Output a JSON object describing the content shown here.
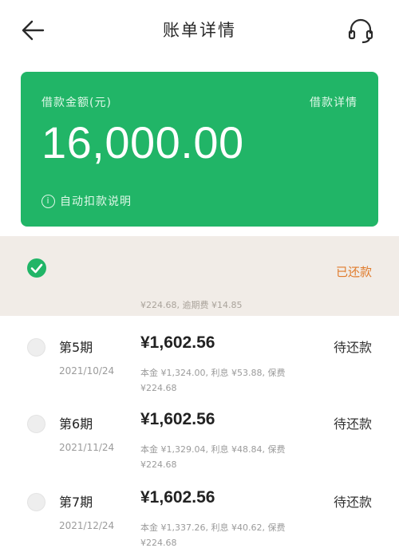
{
  "header": {
    "title": "账单详情",
    "back_icon": "arrow-left-icon",
    "support_icon": "headset-icon"
  },
  "card": {
    "label": "借款金额(元)",
    "detail_link": "借款详情",
    "amount": "16,000.00",
    "auto_pay_info": "自动扣款说明",
    "info_icon": "i",
    "color": "#21b567"
  },
  "obscured_row": {
    "status": "已还款",
    "status_color": "#e07b2c",
    "partial_text": "¥224.68, 逾期费 ¥14.85"
  },
  "installments": [
    {
      "period": "第5期",
      "date": "2021/10/24",
      "amount": "¥1,602.56",
      "detail": "本金 ¥1,324.00, 利息 ¥53.88, 保费 ¥224.68",
      "status": "待还款"
    },
    {
      "period": "第6期",
      "date": "2021/11/24",
      "amount": "¥1,602.56",
      "detail": "本金 ¥1,329.04, 利息 ¥48.84, 保费 ¥224.68",
      "status": "待还款"
    },
    {
      "period": "第7期",
      "date": "2021/12/24",
      "amount": "¥1,602.56",
      "detail": "本金 ¥1,337.26, 利息 ¥40.62, 保费 ¥224.68",
      "status": "待还款"
    }
  ]
}
